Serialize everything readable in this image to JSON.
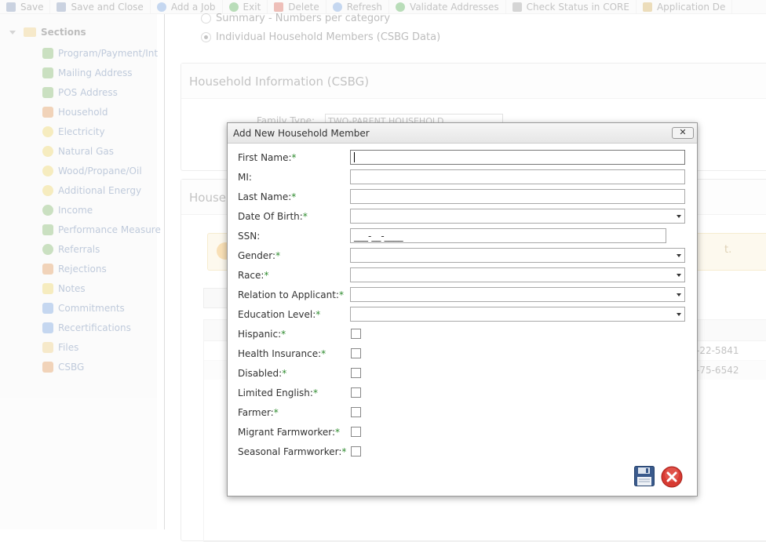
{
  "toolbar": {
    "items": [
      {
        "label": "Save",
        "icon": "floppy-disk-icon",
        "color": "#6b7fa8"
      },
      {
        "label": "Save and Close",
        "icon": "save-close-icon",
        "color": "#6b7fa8"
      },
      {
        "label": "Add a Job",
        "icon": "add-icon",
        "color": "#5b8fd6"
      },
      {
        "label": "Exit",
        "icon": "exit-icon",
        "color": "#3aa13a"
      },
      {
        "label": "Delete",
        "icon": "delete-icon",
        "color": "#d04a3a"
      },
      {
        "label": "Refresh",
        "icon": "refresh-icon",
        "color": "#5b8fd6"
      },
      {
        "label": "Validate Addresses",
        "icon": "check-icon",
        "color": "#3aa13a"
      },
      {
        "label": "Check Status in CORE",
        "icon": "status-icon",
        "color": "#888888"
      },
      {
        "label": "Application De",
        "icon": "clipboard-icon",
        "color": "#c9a040"
      }
    ]
  },
  "sidebar": {
    "header": "Sections",
    "items": [
      {
        "label": "Program/Payment/Int",
        "icon": "payment-icon",
        "color": "#6aa84f"
      },
      {
        "label": "Mailing Address",
        "icon": "house-icon",
        "color": "#6aa84f"
      },
      {
        "label": "POS Address",
        "icon": "house-icon",
        "color": "#6aa84f"
      },
      {
        "label": "Household",
        "icon": "people-icon",
        "color": "#d9843a"
      },
      {
        "label": "Electricity",
        "icon": "bulb-icon",
        "color": "#e8c94a"
      },
      {
        "label": "Natural Gas",
        "icon": "bulb-icon",
        "color": "#e8c94a"
      },
      {
        "label": "Wood/Propane/Oil",
        "icon": "bulb-icon",
        "color": "#e8c94a"
      },
      {
        "label": "Additional Energy",
        "icon": "bulb-icon",
        "color": "#e8c94a"
      },
      {
        "label": "Income",
        "icon": "money-icon",
        "color": "#6aa84f"
      },
      {
        "label": "Performance Measure",
        "icon": "chart-icon",
        "color": "#6aa84f"
      },
      {
        "label": "Referrals",
        "icon": "referral-icon",
        "color": "#6aa84f"
      },
      {
        "label": "Rejections",
        "icon": "rejection-icon",
        "color": "#d9843a"
      },
      {
        "label": "Notes",
        "icon": "note-icon",
        "color": "#e8c94a"
      },
      {
        "label": "Commitments",
        "icon": "commitment-icon",
        "color": "#5b8fd6"
      },
      {
        "label": "Recertifications",
        "icon": "recert-icon",
        "color": "#5b8fd6"
      },
      {
        "label": "Files",
        "icon": "folder-icon",
        "color": "#e8c36a"
      },
      {
        "label": "CSBG",
        "icon": "csbg-icon",
        "color": "#d9843a"
      }
    ]
  },
  "background": {
    "radio_summary": "Summary - Numbers per category",
    "radio_individual": "Individual Household Members (CSBG Data)",
    "household_info_title": "Household Information (CSBG)",
    "family_type_label": "Family Type:",
    "family_type_value": "TWO-PARENT HOUSEHOLD",
    "household_panel_title": "Househ",
    "alert_fragment": "t.",
    "row1_fragment": "-22-5841",
    "row2_fragment": "-75-6542"
  },
  "modal": {
    "title": "Add New Household Member",
    "close_label": "✕",
    "fields": {
      "first_name": {
        "label": "First Name:",
        "value": ""
      },
      "mi": {
        "label": "MI:",
        "value": ""
      },
      "last_name": {
        "label": "Last Name:",
        "value": ""
      },
      "dob": {
        "label": "Date Of Birth:",
        "value": ""
      },
      "ssn": {
        "label": "SSN:",
        "value": "___-__-____"
      },
      "gender": {
        "label": "Gender:",
        "value": ""
      },
      "race": {
        "label": "Race:",
        "value": ""
      },
      "relation": {
        "label": "Relation to Applicant:",
        "value": ""
      },
      "education": {
        "label": "Education Level:",
        "value": ""
      },
      "hispanic": {
        "label": "Hispanic:",
        "checked": false
      },
      "health_insurance": {
        "label": "Health Insurance:",
        "checked": false
      },
      "disabled": {
        "label": "Disabled:",
        "checked": false
      },
      "limited_english": {
        "label": "Limited English:",
        "checked": false
      },
      "farmer": {
        "label": "Farmer:",
        "checked": false
      },
      "migrant_farmworker": {
        "label": "Migrant Farmworker:",
        "checked": false
      },
      "seasonal_farmworker": {
        "label": "Seasonal Farmworker:",
        "checked": false
      }
    },
    "required_marker": "*",
    "save_icon": "floppy-disk-icon",
    "cancel_icon": "cancel-x-icon"
  }
}
